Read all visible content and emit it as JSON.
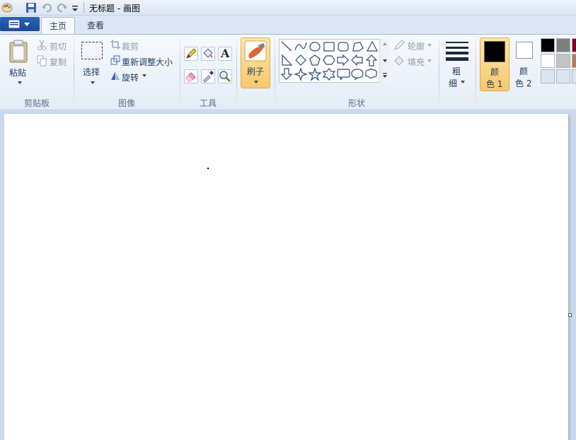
{
  "window": {
    "title": "无标题 - 画图"
  },
  "tabs": {
    "home": "主页",
    "view": "查看"
  },
  "clipboard": {
    "paste": "粘贴",
    "cut": "剪切",
    "copy": "复制",
    "group": "剪贴板"
  },
  "image": {
    "select": "选择",
    "crop": "裁剪",
    "resize": "重新调整大小",
    "rotate": "旋转",
    "group": "图像"
  },
  "tools": {
    "text_glyph": "A",
    "group": "工具"
  },
  "brushes": {
    "label": "刷子"
  },
  "shapes": {
    "outline": "轮廓",
    "fill": "填充",
    "group": "形状"
  },
  "size": {
    "label_line1": "粗",
    "label_line2": "细"
  },
  "colors": {
    "color1_line1": "颜",
    "color1_line2": "色 1",
    "color2_line1": "颜",
    "color2_line2": "色 2",
    "color1_value": "#000000",
    "color2_value": "#ffffff",
    "palette_row1": [
      "#000000",
      "#7f7f7f",
      "#880015"
    ],
    "palette_row2": [
      "#ffffff",
      "#c3c3c3",
      "#b97a57"
    ],
    "palette_row3": [
      "#dce6f0",
      "#dce6f0",
      "#dce6f0"
    ]
  }
}
